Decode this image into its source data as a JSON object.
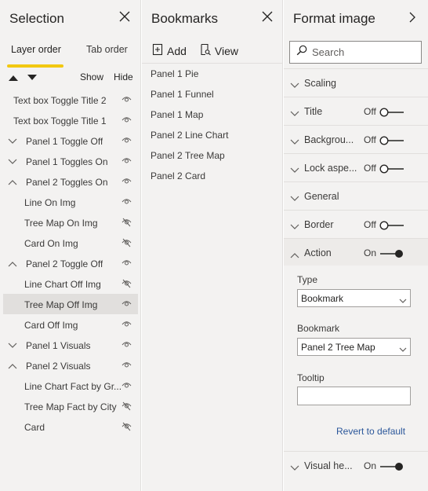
{
  "selection": {
    "title": "Selection",
    "tabs": [
      "Layer order",
      "Tab order"
    ],
    "show_label": "Show",
    "hide_label": "Hide",
    "layers": [
      {
        "label": "Text box Toggle Title 2",
        "indent": 0,
        "chevron": "none",
        "visible": true,
        "selected": false
      },
      {
        "label": "Text box Toggle Title 1",
        "indent": 0,
        "chevron": "none",
        "visible": true,
        "selected": false
      },
      {
        "label": "Panel 1 Toggle Off",
        "indent": 0,
        "chevron": "down",
        "visible": true,
        "selected": false
      },
      {
        "label": "Panel 1 Toggles On",
        "indent": 0,
        "chevron": "down",
        "visible": true,
        "selected": false
      },
      {
        "label": "Panel 2 Toggles On",
        "indent": 0,
        "chevron": "up",
        "visible": true,
        "selected": false
      },
      {
        "label": "Line On Img",
        "indent": 1,
        "chevron": "none",
        "visible": true,
        "selected": false
      },
      {
        "label": "Tree Map On Img",
        "indent": 1,
        "chevron": "none",
        "visible": false,
        "selected": false
      },
      {
        "label": "Card On Img",
        "indent": 1,
        "chevron": "none",
        "visible": false,
        "selected": false
      },
      {
        "label": "Panel 2 Toggle Off",
        "indent": 0,
        "chevron": "up",
        "visible": true,
        "selected": false
      },
      {
        "label": "Line Chart Off Img",
        "indent": 1,
        "chevron": "none",
        "visible": false,
        "selected": false
      },
      {
        "label": "Tree Map Off Img",
        "indent": 1,
        "chevron": "none",
        "visible": true,
        "selected": true
      },
      {
        "label": "Card Off Img",
        "indent": 1,
        "chevron": "none",
        "visible": true,
        "selected": false
      },
      {
        "label": "Panel 1 Visuals",
        "indent": 0,
        "chevron": "down",
        "visible": true,
        "selected": false
      },
      {
        "label": "Panel 2 Visuals",
        "indent": 0,
        "chevron": "up",
        "visible": true,
        "selected": false
      },
      {
        "label": "Line Chart Fact by Gr...",
        "indent": 1,
        "chevron": "none",
        "visible": true,
        "selected": false
      },
      {
        "label": "Tree Map Fact by City",
        "indent": 1,
        "chevron": "none",
        "visible": false,
        "selected": false
      },
      {
        "label": "Card",
        "indent": 1,
        "chevron": "none",
        "visible": false,
        "selected": false
      }
    ]
  },
  "bookmarks": {
    "title": "Bookmarks",
    "add_label": "Add",
    "view_label": "View",
    "items": [
      "Panel 1 Pie",
      "Panel 1 Funnel",
      "Panel 1 Map",
      "Panel 2 Line Chart",
      "Panel 2 Tree Map",
      "Panel 2 Card"
    ]
  },
  "format": {
    "title": "Format image",
    "search_placeholder": "Search",
    "sections": [
      {
        "label": "Scaling",
        "expanded": false,
        "toggle": null
      },
      {
        "label": "Title",
        "expanded": false,
        "toggle": "Off"
      },
      {
        "label": "Backgrou...",
        "expanded": false,
        "toggle": "Off"
      },
      {
        "label": "Lock aspe...",
        "expanded": false,
        "toggle": "Off"
      },
      {
        "label": "General",
        "expanded": false,
        "toggle": null
      },
      {
        "label": "Border",
        "expanded": false,
        "toggle": "Off"
      },
      {
        "label": "Action",
        "expanded": true,
        "toggle": "On"
      }
    ],
    "action": {
      "type_label": "Type",
      "type_value": "Bookmark",
      "bookmark_label": "Bookmark",
      "bookmark_value": "Panel 2 Tree Map",
      "tooltip_label": "Tooltip",
      "revert_label": "Revert to default"
    },
    "visual_header": {
      "label": "Visual he...",
      "toggle": "On"
    }
  },
  "colors": {
    "accent": "#f2c811",
    "pane_bg": "#f3f2f1",
    "selected_bg": "#e1dfdd",
    "link": "#2b579a",
    "text": "#252423"
  }
}
